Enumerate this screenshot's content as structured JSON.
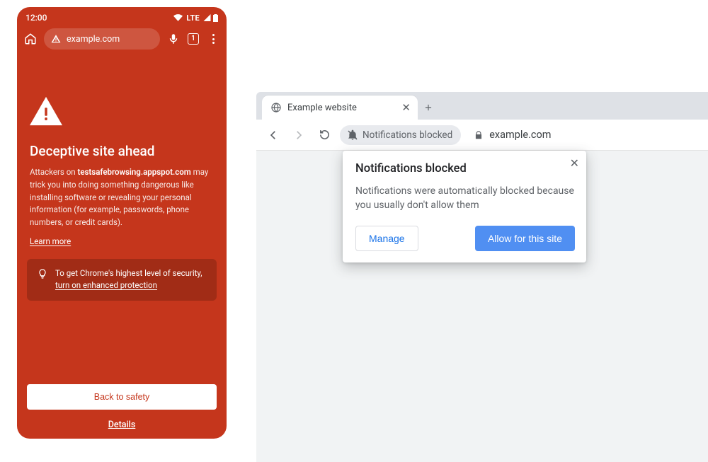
{
  "mobile": {
    "time": "12:00",
    "signal_label": "LTE",
    "url": "example.com",
    "tab_count": "1",
    "heading": "Deceptive site ahead",
    "body_pre": "Attackers on ",
    "body_bold": "testsafebrowsing.appspot.com",
    "body_post": " may trick you into doing something dangerous like installing software or revealing your personal information (for example, passwords, phone numbers, or credit cards).",
    "learn_more": "Learn more",
    "tip_pre": "To get Chrome's highest level of security, ",
    "tip_link": "turn on enhanced protection",
    "back_to_safety": "Back to safety",
    "details": "Details"
  },
  "desktop": {
    "tab_title": "Example website",
    "chip_label": "Notifications blocked",
    "url": "example.com",
    "popup_title": "Notifications blocked",
    "popup_body": "Notifications were automatically blocked because you usually don't allow them",
    "manage": "Manage",
    "allow": "Allow for this site"
  }
}
